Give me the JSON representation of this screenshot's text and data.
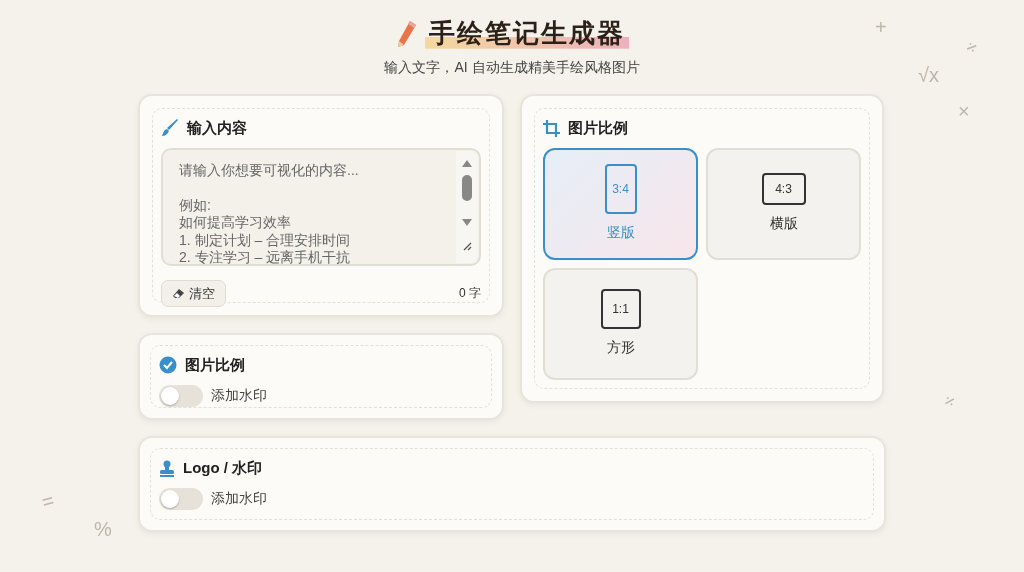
{
  "header": {
    "title": "手绘笔记生成器",
    "subtitle": "输入文字，AI 自动生成精美手绘风格图片"
  },
  "input_panel": {
    "title": "输入内容",
    "placeholder": "请输入你想要可视化的内容...\n\n例如:\n如何提高学习效率\n1. 制定计划 – 合理安排时间\n2. 专注学习 – 远离手机干抗",
    "clear_button": "清空",
    "char_count": "0 字"
  },
  "option_panel": {
    "title": "图片比例",
    "checked": true,
    "toggle": {
      "label": "添加水印",
      "on": false
    }
  },
  "ratio_panel": {
    "title": "图片比例",
    "options": [
      {
        "ratio": "3:4",
        "label": "竖版",
        "kind": "portrait",
        "selected": true
      },
      {
        "ratio": "4:3",
        "label": "横版",
        "kind": "landscape",
        "selected": false
      },
      {
        "ratio": "1:1",
        "label": "方形",
        "kind": "square",
        "selected": false
      }
    ]
  },
  "logo_panel": {
    "title": "Logo / 水印",
    "toggle": {
      "label": "添加水印",
      "on": false
    }
  },
  "decorations": [
    "+",
    "÷",
    "√x",
    "×",
    "÷",
    "=",
    "%"
  ]
}
